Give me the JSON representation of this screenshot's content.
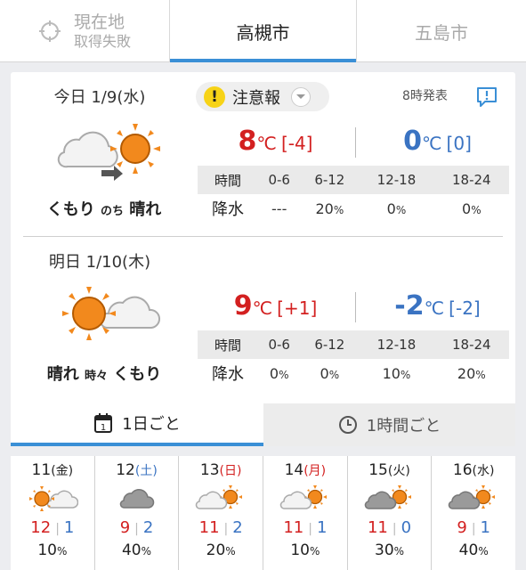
{
  "tabs": {
    "location": {
      "title": "現在地",
      "subtitle": "取得失敗"
    },
    "active_city": "高槻市",
    "other_city": "五島市"
  },
  "alert": {
    "icon": "exclamation-icon",
    "label": "注意報"
  },
  "issued": "8時発表",
  "days": [
    {
      "date": "今日 1/9(水)",
      "weather_main1": "くもり",
      "weather_join": "のち",
      "weather_main2": "晴れ",
      "icon": "cloudy-then-sunny-icon",
      "high": "8",
      "high_diff": "[-4]",
      "low": "0",
      "low_diff": "[0]",
      "unit": "℃",
      "time_label": "時間",
      "rain_label": "降水",
      "periods": [
        "0-6",
        "6-12",
        "12-18",
        "18-24"
      ],
      "rain": [
        {
          "v": "---",
          "u": ""
        },
        {
          "v": "20",
          "u": "%"
        },
        {
          "v": "0",
          "u": "%"
        },
        {
          "v": "0",
          "u": "%"
        }
      ]
    },
    {
      "date": "明日 1/10(木)",
      "weather_main1": "晴れ",
      "weather_join": "時々",
      "weather_main2": "くもり",
      "icon": "sunny-sometimes-cloudy-icon",
      "high": "9",
      "high_diff": "[+1]",
      "low": "-2",
      "low_diff": "[-2]",
      "unit": "℃",
      "time_label": "時間",
      "rain_label": "降水",
      "periods": [
        "0-6",
        "6-12",
        "12-18",
        "18-24"
      ],
      "rain": [
        {
          "v": "0",
          "u": "%"
        },
        {
          "v": "0",
          "u": "%"
        },
        {
          "v": "10",
          "u": "%"
        },
        {
          "v": "20",
          "u": "%"
        }
      ]
    }
  ],
  "mode": {
    "daily": "1日ごと",
    "hourly": "1時間ごと",
    "calendar_num": "1"
  },
  "week": [
    {
      "day": "11",
      "dow": "(金)",
      "dow_type": "weekday",
      "icon": "sunny-cloudy-icon",
      "hi": "12",
      "lo": "1",
      "rain": "10",
      "unit": "%"
    },
    {
      "day": "12",
      "dow": "(土)",
      "dow_type": "sat",
      "icon": "cloudy-icon",
      "hi": "9",
      "lo": "2",
      "rain": "40",
      "unit": "%"
    },
    {
      "day": "13",
      "dow": "(日)",
      "dow_type": "sun",
      "icon": "cloudy-sunny-icon",
      "hi": "11",
      "lo": "2",
      "rain": "20",
      "unit": "%"
    },
    {
      "day": "14",
      "dow": "(月)",
      "dow_type": "sun",
      "icon": "cloudy-sunny-icon",
      "hi": "11",
      "lo": "1",
      "rain": "10",
      "unit": "%"
    },
    {
      "day": "15",
      "dow": "(火)",
      "dow_type": "weekday",
      "icon": "cloudy-sunny-icon",
      "hi": "11",
      "lo": "0",
      "rain": "30",
      "unit": "%"
    },
    {
      "day": "16",
      "dow": "(水)",
      "dow_type": "weekday",
      "icon": "cloudy-sunny-icon",
      "hi": "9",
      "lo": "1",
      "rain": "40",
      "unit": "%"
    }
  ],
  "colors": {
    "accent": "#3a8fd6",
    "high": "#d32020",
    "low": "#3a73c2",
    "sun": "#f2891d",
    "alert": "#f7d317"
  }
}
